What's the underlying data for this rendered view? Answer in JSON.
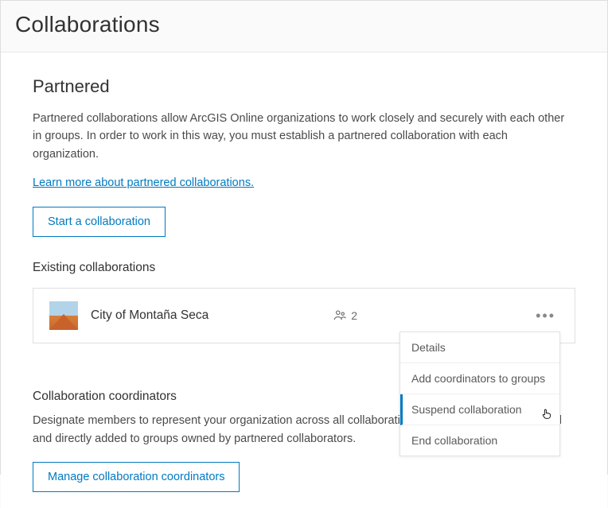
{
  "page": {
    "title": "Collaborations"
  },
  "partnered": {
    "heading": "Partnered",
    "description": "Partnered collaborations allow ArcGIS Online organizations to work closely and securely with each other in groups. In order to work in this way, you must establish a partnered collaboration with each organization.",
    "learn_link": "Learn more about partnered collaborations.",
    "start_button": "Start a collaboration",
    "existing_label": "Existing collaborations"
  },
  "collaboration": {
    "name": "City of Montaña Seca",
    "member_count": "2"
  },
  "dropdown": {
    "items": [
      {
        "label": "Details"
      },
      {
        "label": "Add coordinators to groups"
      },
      {
        "label": "Suspend collaboration"
      },
      {
        "label": "End collaboration"
      }
    ]
  },
  "coordinators": {
    "heading": "Collaboration coordinators",
    "description": "Designate members to represent your organization across all collaborations so they can easily be found and directly added to groups owned by partnered collaborators.",
    "manage_button": "Manage collaboration coordinators"
  }
}
